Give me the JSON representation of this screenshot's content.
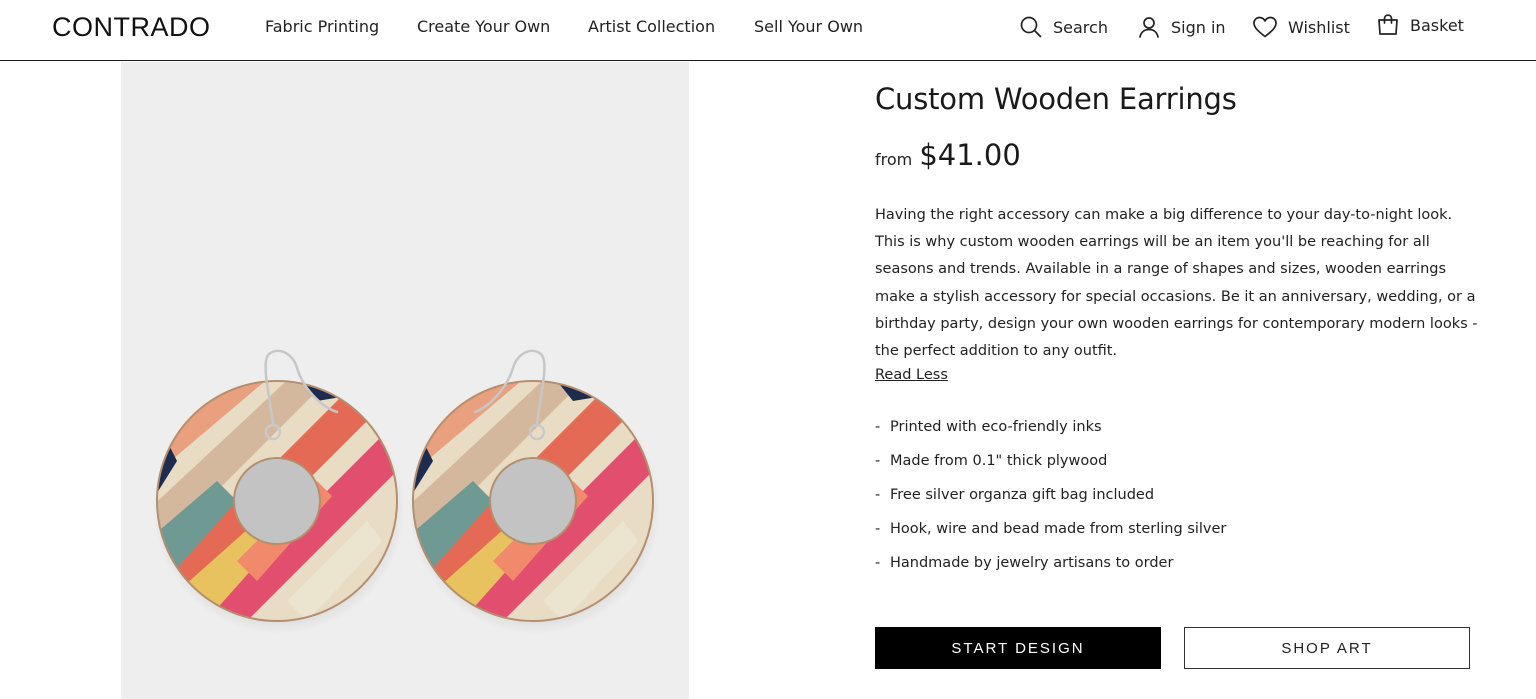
{
  "brand": {
    "logo": "CONTRADO"
  },
  "nav": {
    "items": [
      {
        "label": "Fabric Printing"
      },
      {
        "label": "Create Your Own"
      },
      {
        "label": "Artist Collection"
      },
      {
        "label": "Sell Your Own"
      }
    ]
  },
  "utility": {
    "search": {
      "label": "Search",
      "icon": "search-icon"
    },
    "sign_in": {
      "label": "Sign in",
      "icon": "user-icon"
    },
    "wishlist": {
      "label": "Wishlist",
      "icon": "heart-icon"
    },
    "basket": {
      "label": "Basket",
      "icon": "shopping-bag-icon"
    }
  },
  "product": {
    "title": "Custom Wooden Earrings",
    "price_prefix": "from",
    "price": "$41.00",
    "description": "Having the right accessory can make a big difference to your day-to-night look. This is why custom wooden earrings will be an item you'll be reaching for all seasons and trends. Available in a range of shapes and sizes, wooden earrings make a stylish accessory for special occasions. Be it an anniversary, wedding, or a birthday party, design your own wooden earrings for contemporary modern looks - the perfect addition to any outfit.",
    "read_less": "Read Less",
    "features": [
      "Printed with eco-friendly inks",
      "Made from 0.1\" thick plywood",
      "Free silver organza gift bag included",
      "Hook, wire and bead made from sterling silver",
      "Handmade by jewelry artisans to order"
    ],
    "feature_bullet": "-"
  },
  "actions": {
    "start_design": "START DESIGN",
    "shop_art": "SHOP ART"
  },
  "colors": {
    "primary_button": "#000000",
    "image_background": "#eeeeee"
  }
}
